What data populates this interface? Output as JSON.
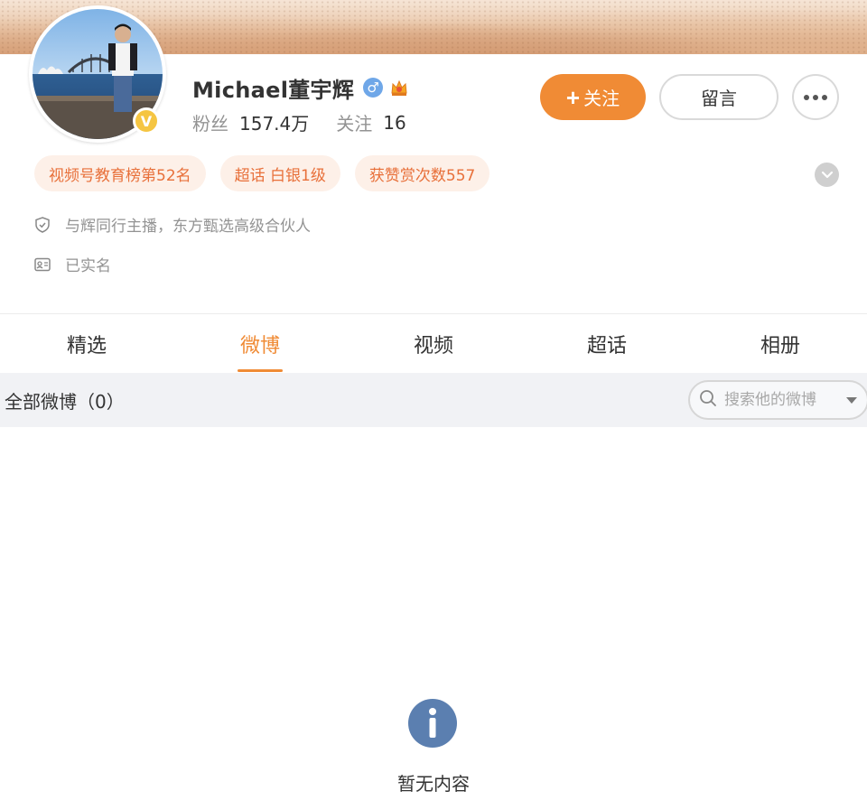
{
  "profile": {
    "name": "Michael董宇辉",
    "gender_symbol": "♂",
    "verified_mark": "V",
    "fans_label": "粉丝",
    "fans_count": "157.4万",
    "following_label": "关注",
    "following_count": "16"
  },
  "actions": {
    "follow_plus": "+",
    "follow_label": "关注",
    "message_label": "留言"
  },
  "tags": [
    "视频号教育榜第52名",
    "超话 白银1级",
    "获赞赏次数557"
  ],
  "info": {
    "description": "与辉同行主播，东方甄选高级合伙人",
    "realname": "已实名"
  },
  "tabs": [
    {
      "label": "精选",
      "active": false
    },
    {
      "label": "微博",
      "active": true
    },
    {
      "label": "视频",
      "active": false
    },
    {
      "label": "超话",
      "active": false
    },
    {
      "label": "相册",
      "active": false
    }
  ],
  "feed": {
    "title": "全部微博（0）",
    "search_placeholder": "搜索他的微博"
  },
  "empty": {
    "text": "暂无内容"
  },
  "colors": {
    "accent": "#f08b35",
    "tag_bg": "#fdf0e8",
    "tag_text": "#e8703a",
    "empty_icon": "#5b7fb0"
  }
}
